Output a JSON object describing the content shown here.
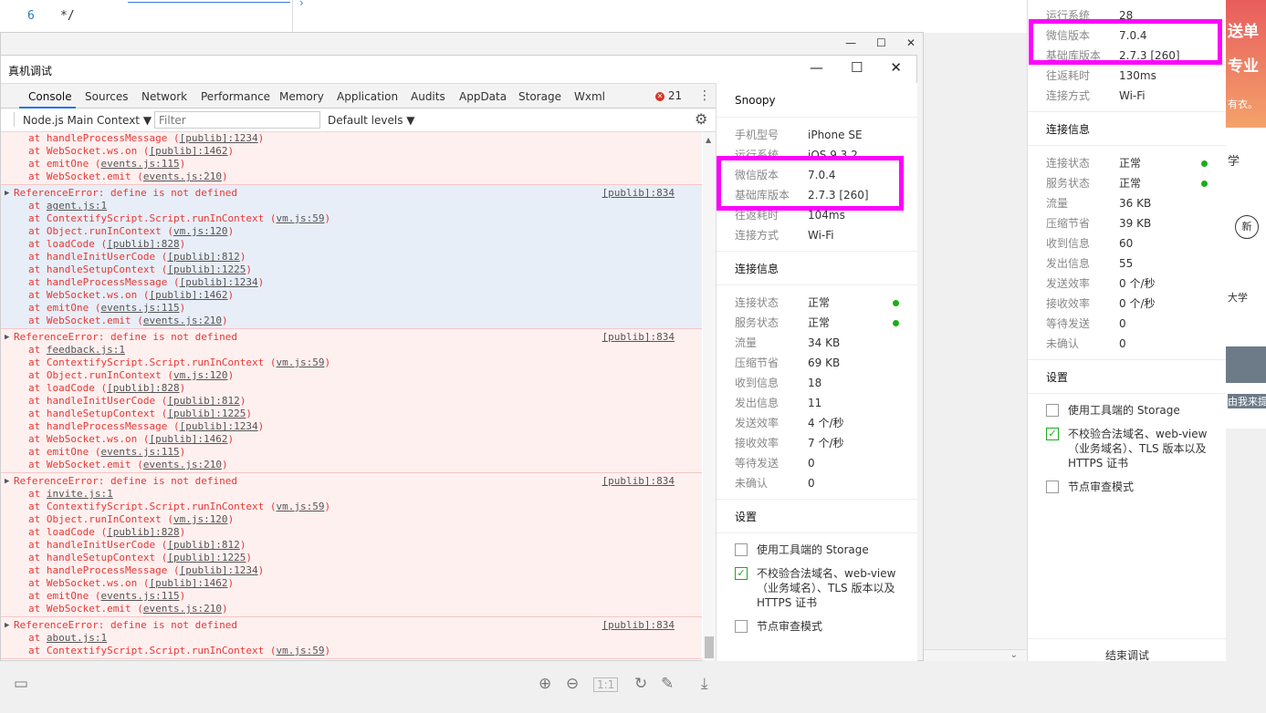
{
  "editor": {
    "line_number": "6",
    "code": "*/"
  },
  "outer_window": {
    "min": "—",
    "max": "☐",
    "close": "✕"
  },
  "inner_window": {
    "title": "真机调试",
    "min": "—",
    "max": "☐",
    "close": "✕"
  },
  "devtools": {
    "tabs": [
      "Console",
      "Sources",
      "Network",
      "Performance",
      "Memory",
      "Application",
      "Audits",
      "AppData",
      "Storage",
      "Wxml"
    ],
    "error_count": "21",
    "context": "Node.js Main Context",
    "filter_placeholder": "Filter",
    "levels": "Default levels"
  },
  "console": {
    "top_lines": [
      {
        "t": "at handleProcessMessage (",
        "l": "[publib]:1234",
        "e": ")"
      },
      {
        "t": "at WebSocket.ws.on (",
        "l": "[publib]:1462",
        "e": ")"
      },
      {
        "t": "at emitOne (",
        "l": "events.js:115",
        "e": ")"
      },
      {
        "t": "at WebSocket.emit (",
        "l": "events.js:210",
        "e": ")"
      }
    ],
    "entries": [
      {
        "msg": "ReferenceError: define is not defined",
        "src": "[publib]:834",
        "selected": true,
        "lines": [
          {
            "t": "at ",
            "l": "agent.js:1",
            "e": ""
          },
          {
            "t": "at ContextifyScript.Script.runInContext (",
            "l": "vm.js:59",
            "e": ")"
          },
          {
            "t": "at Object.runInContext (",
            "l": "vm.js:120",
            "e": ")"
          },
          {
            "t": "at loadCode (",
            "l": "[publib]:828",
            "e": ")"
          },
          {
            "t": "at handleInitUserCode (",
            "l": "[publib]:812",
            "e": ")"
          },
          {
            "t": "at handleSetupContext (",
            "l": "[publib]:1225",
            "e": ")"
          },
          {
            "t": "at handleProcessMessage (",
            "l": "[publib]:1234",
            "e": ")"
          },
          {
            "t": "at WebSocket.ws.on (",
            "l": "[publib]:1462",
            "e": ")"
          },
          {
            "t": "at emitOne (",
            "l": "events.js:115",
            "e": ")"
          },
          {
            "t": "at WebSocket.emit (",
            "l": "events.js:210",
            "e": ")"
          }
        ]
      },
      {
        "msg": "ReferenceError: define is not defined",
        "src": "[publib]:834",
        "selected": false,
        "lines": [
          {
            "t": "at ",
            "l": "feedback.js:1",
            "e": ""
          },
          {
            "t": "at ContextifyScript.Script.runInContext (",
            "l": "vm.js:59",
            "e": ")"
          },
          {
            "t": "at Object.runInContext (",
            "l": "vm.js:120",
            "e": ")"
          },
          {
            "t": "at loadCode (",
            "l": "[publib]:828",
            "e": ")"
          },
          {
            "t": "at handleInitUserCode (",
            "l": "[publib]:812",
            "e": ")"
          },
          {
            "t": "at handleSetupContext (",
            "l": "[publib]:1225",
            "e": ")"
          },
          {
            "t": "at handleProcessMessage (",
            "l": "[publib]:1234",
            "e": ")"
          },
          {
            "t": "at WebSocket.ws.on (",
            "l": "[publib]:1462",
            "e": ")"
          },
          {
            "t": "at emitOne (",
            "l": "events.js:115",
            "e": ")"
          },
          {
            "t": "at WebSocket.emit (",
            "l": "events.js:210",
            "e": ")"
          }
        ]
      },
      {
        "msg": "ReferenceError: define is not defined",
        "src": "[publib]:834",
        "selected": false,
        "lines": [
          {
            "t": "at ",
            "l": "invite.js:1",
            "e": ""
          },
          {
            "t": "at ContextifyScript.Script.runInContext (",
            "l": "vm.js:59",
            "e": ")"
          },
          {
            "t": "at Object.runInContext (",
            "l": "vm.js:120",
            "e": ")"
          },
          {
            "t": "at loadCode (",
            "l": "[publib]:828",
            "e": ")"
          },
          {
            "t": "at handleInitUserCode (",
            "l": "[publib]:812",
            "e": ")"
          },
          {
            "t": "at handleSetupContext (",
            "l": "[publib]:1225",
            "e": ")"
          },
          {
            "t": "at handleProcessMessage (",
            "l": "[publib]:1234",
            "e": ")"
          },
          {
            "t": "at WebSocket.ws.on (",
            "l": "[publib]:1462",
            "e": ")"
          },
          {
            "t": "at emitOne (",
            "l": "events.js:115",
            "e": ")"
          },
          {
            "t": "at WebSocket.emit (",
            "l": "events.js:210",
            "e": ")"
          }
        ]
      },
      {
        "msg": "ReferenceError: define is not defined",
        "src": "[publib]:834",
        "selected": false,
        "lines": [
          {
            "t": "at ",
            "l": "about.js:1",
            "e": ""
          },
          {
            "t": "at ContextifyScript.Script.runInContext (",
            "l": "vm.js:59",
            "e": ")"
          }
        ]
      }
    ]
  },
  "snoopy_main": {
    "title": "Snoopy",
    "info": [
      {
        "k": "手机型号",
        "v": "iPhone SE"
      },
      {
        "k": "运行系统",
        "v": "iOS 9.3.2"
      },
      {
        "k": "微信版本",
        "v": "7.0.4"
      },
      {
        "k": "基础库版本",
        "v": "2.7.3 [260]"
      },
      {
        "k": "往返耗时",
        "v": "104ms"
      },
      {
        "k": "连接方式",
        "v": "Wi-Fi"
      }
    ],
    "conn_title": "连接信息",
    "conn": [
      {
        "k": "连接状态",
        "v": "正常",
        "dot": true
      },
      {
        "k": "服务状态",
        "v": "正常",
        "dot": true
      },
      {
        "k": "流量",
        "v": "34 KB"
      },
      {
        "k": "压缩节省",
        "v": "69 KB"
      },
      {
        "k": "收到信息",
        "v": "18"
      },
      {
        "k": "发出信息",
        "v": "11"
      },
      {
        "k": "发送效率",
        "v": "4 个/秒"
      },
      {
        "k": "接收效率",
        "v": "7 个/秒"
      },
      {
        "k": "等待发送",
        "v": "0"
      },
      {
        "k": "未确认",
        "v": "0"
      }
    ],
    "settings_title": "设置",
    "settings": [
      {
        "label": "使用工具端的 Storage",
        "checked": false
      },
      {
        "label": "不校验合法域名、web-view（业务域名）、TLS 版本以及 HTTPS 证书",
        "checked": true
      },
      {
        "label": "节点审查模式",
        "checked": false
      }
    ]
  },
  "snoopy_bg": {
    "info": [
      {
        "k": "运行系统",
        "v": "28"
      },
      {
        "k": "微信版本",
        "v": "7.0.4"
      },
      {
        "k": "基础库版本",
        "v": "2.7.3 [260]"
      },
      {
        "k": "往返耗时",
        "v": "130ms"
      },
      {
        "k": "连接方式",
        "v": "Wi-Fi"
      }
    ],
    "conn_title": "连接信息",
    "conn": [
      {
        "k": "连接状态",
        "v": "正常",
        "dot": true
      },
      {
        "k": "服务状态",
        "v": "正常",
        "dot": true
      },
      {
        "k": "流量",
        "v": "36 KB"
      },
      {
        "k": "压缩节省",
        "v": "39 KB"
      },
      {
        "k": "收到信息",
        "v": "60"
      },
      {
        "k": "发出信息",
        "v": "55"
      },
      {
        "k": "发送效率",
        "v": "0 个/秒"
      },
      {
        "k": "接收效率",
        "v": "0 个/秒"
      },
      {
        "k": "等待发送",
        "v": "0"
      },
      {
        "k": "未确认",
        "v": "0"
      }
    ],
    "settings_title": "设置",
    "settings": [
      {
        "label": "使用工具端的 Storage",
        "checked": false
      },
      {
        "label": "不校验合法域名、web-view（业务域名）、TLS 版本以及 HTTPS 证书",
        "checked": true
      },
      {
        "label": "节点审查模式",
        "checked": false
      }
    ],
    "end_debug": "结束调试"
  },
  "right_strip": {
    "t1": "送单",
    "t2": "专业",
    "t3": "有衣。",
    "t4": "学",
    "t5": "新",
    "t6": "大学",
    "t7": "由我来提"
  },
  "colors": {
    "highlight": "#ff00ff",
    "error": "#e53935",
    "ok_dot": "#1aad19",
    "active_tab": "#1a73e8"
  }
}
